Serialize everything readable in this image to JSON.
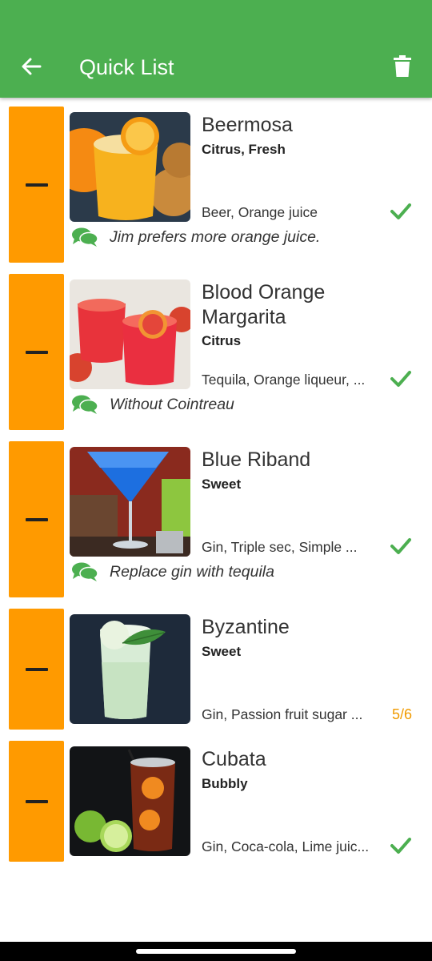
{
  "appbar": {
    "title": "Quick List",
    "back_icon": "arrow-left-icon",
    "delete_icon": "trash-icon",
    "background": "#4caf50"
  },
  "colors": {
    "accent_orange": "#ff9a00",
    "check_green": "#4caf50",
    "count_orange": "#f09a00"
  },
  "items": [
    {
      "name": "Beermosa",
      "category": "Citrus, Fresh",
      "ingredients": "Beer, Orange juice",
      "status": "check",
      "note": "Jim prefers more orange juice."
    },
    {
      "name": "Blood Orange Margarita",
      "category": "Citrus",
      "ingredients": "Tequila, Orange liqueur, ...",
      "status": "check",
      "note": "Without Cointreau"
    },
    {
      "name": "Blue Riband",
      "category": "Sweet",
      "ingredients": "Gin, Triple sec, Simple ...",
      "status": "check",
      "note": "Replace gin with tequila"
    },
    {
      "name": "Byzantine",
      "category": "Sweet",
      "ingredients": "Gin, Passion fruit sugar ...",
      "status": "count",
      "count": "5/6",
      "note": ""
    },
    {
      "name": "Cubata",
      "category": "Bubbly",
      "ingredients": "Gin, Coca-cola, Lime juic...",
      "status": "check",
      "note": ""
    }
  ]
}
